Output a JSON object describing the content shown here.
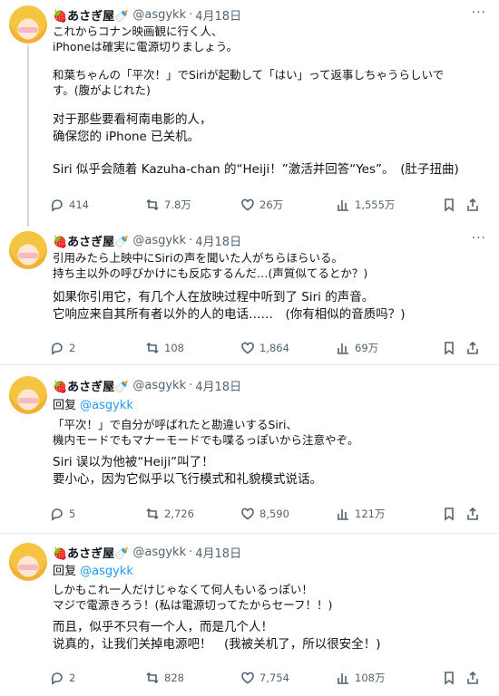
{
  "tweets": [
    {
      "name": "🍓あさぎ屋🍼",
      "handle": "@asgykk",
      "date": "4月18日",
      "reply_to": "",
      "jp": [
        "これからコナン映画観に行く人、",
        "iPhoneは確実に電源切りましょう。",
        "",
        "和葉ちゃんの「平次！」でSiriが起動して「はい」って返事しちゃうらしいで",
        "す。(腹がよじれた)"
      ],
      "cn": [
        "对于那些要看柯南电影的人，",
        "确保您的 iPhone 已关机。",
        "",
        "Siri 似乎会随着 Kazuha-chan 的“Heiji！”激活并回答“Yes”。　(肚子扭曲)"
      ],
      "replies": "414",
      "retweets": "7.8万",
      "likes": "26万",
      "views": "1,555万"
    },
    {
      "name": "🍓あさぎ屋🍼",
      "handle": "@asgykk",
      "date": "4月18日",
      "reply_to": "",
      "jp": [
        "引用みたら上映中にSiriの声を聞いた人がちらほらいる。",
        "持ち主以外の呼びかけにも反応するんだ…(声質似てるとか？)"
      ],
      "cn": [
        "如果你引用它，有几个人在放映过程中听到了 Siri 的声音。",
        "它响应来自其所有者以外的人的电话……　(你有相似的音质吗？)"
      ],
      "replies": "2",
      "retweets": "108",
      "likes": "1,864",
      "views": "69万"
    },
    {
      "name": "🍓あさぎ屋🍼",
      "handle": "@asgykk",
      "date": "4月18日",
      "reply_prefix": "回复",
      "reply_to": "@asgykk",
      "jp": [
        "「平次！」で自分が呼ばれたと勘違いするSiri、",
        "機内モードでもマナーモードでも喋るっぽいから注意やぞ。"
      ],
      "cn": [
        "Siri 误以为他被“Heiji”叫了！",
        "要小心，因为它似乎以飞行模式和礼貌模式说话。"
      ],
      "replies": "5",
      "retweets": "2,726",
      "likes": "8,590",
      "views": "121万"
    },
    {
      "name": "🍓あさぎ屋🍼",
      "handle": "@asgykk",
      "date": "4月18日",
      "reply_prefix": "回复",
      "reply_to": "@asgykk",
      "jp": [
        "しかもこれ一人だけじゃなくて何人もいるっぽい！",
        "マジで電源きろう！(私は電源切ってたからセーフ！！)"
      ],
      "cn": [
        "而且，似乎不只有一个人，而是几个人！",
        "说真的，让我们关掉电源吧！　(我被关机了，所以很安全！)"
      ],
      "replies": "2",
      "retweets": "828",
      "likes": "7,754",
      "views": "108万"
    }
  ],
  "more_label": "···",
  "header_sep": "·",
  "colors": {
    "link": "#1d9bf0",
    "muted": "#536471",
    "divider": "#e6ecf0"
  },
  "icons": [
    "more-icon",
    "reply-icon",
    "retweet-icon",
    "like-icon",
    "views-icon",
    "bookmark-icon",
    "share-icon"
  ]
}
